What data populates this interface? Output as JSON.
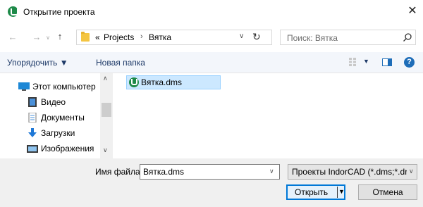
{
  "window": {
    "title": "Открытие проекта",
    "app_icon": "indorcad-logo-icon",
    "close_icon": "close-icon"
  },
  "nav": {
    "back_icon": "arrow-left-icon",
    "forward_icon": "arrow-right-icon",
    "recent_icon": "chevron-down-icon",
    "up_icon": "arrow-up-icon"
  },
  "address": {
    "overflow": "«",
    "crumbs": [
      "Projects",
      "Вятка"
    ],
    "separator": "›",
    "dropdown_icon": "chevron-down-icon",
    "refresh_icon": "refresh-icon"
  },
  "search": {
    "placeholder": "Поиск: Вятка",
    "icon": "search-icon"
  },
  "toolbar": {
    "organize_label": "Упорядочить ▼",
    "new_folder_label": "Новая папка",
    "view_icon": "view-options-icon",
    "preview_icon": "preview-pane-icon",
    "help_icon": "help-icon",
    "help_glyph": "?"
  },
  "navpane": {
    "items": [
      {
        "label": "Этот компьютер",
        "icon": "computer-icon"
      },
      {
        "label": "Видео",
        "icon": "video-icon"
      },
      {
        "label": "Документы",
        "icon": "documents-icon"
      },
      {
        "label": "Загрузки",
        "icon": "downloads-icon"
      },
      {
        "label": "Изображения",
        "icon": "images-icon"
      }
    ]
  },
  "files": [
    {
      "name": "Вятка.dms",
      "icon": "indorcad-file-icon",
      "selected": true
    }
  ],
  "footer": {
    "filename_label": "Имя файла:",
    "filename_value": "Вятка.dms",
    "filetype_value": "Проекты IndorCAD (*.dms;*.dr",
    "open_label": "Открыть",
    "cancel_label": "Отмена"
  },
  "colors": {
    "accent": "#0078d7",
    "selection": "#cce8ff",
    "app_green": "#1e8a49"
  }
}
